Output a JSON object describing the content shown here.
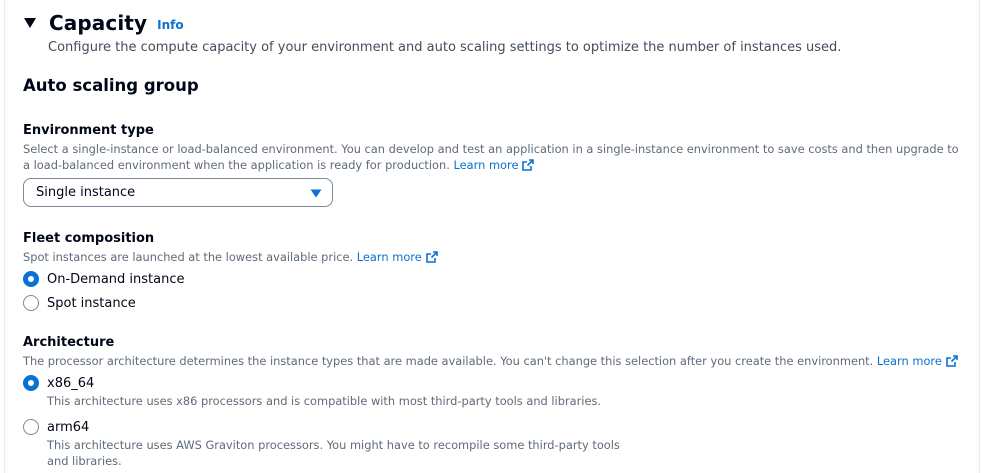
{
  "section": {
    "title": "Capacity",
    "info_label": "Info",
    "description": "Configure the compute capacity of your environment and auto scaling settings to optimize the number of instances used."
  },
  "auto_scaling": {
    "heading": "Auto scaling group"
  },
  "environment_type": {
    "label": "Environment type",
    "description": "Select a single-instance or load-balanced environment. You can develop and test an application in a single-instance environment to save costs and then upgrade to a load-balanced environment when the application is ready for production.",
    "learn_more": "Learn more",
    "selected_value": "Single instance"
  },
  "fleet_composition": {
    "label": "Fleet composition",
    "description": "Spot instances are launched at the lowest available price.",
    "learn_more": "Learn more",
    "options": [
      {
        "label": "On-Demand instance",
        "checked": true
      },
      {
        "label": "Spot instance",
        "checked": false
      }
    ]
  },
  "architecture": {
    "label": "Architecture",
    "description": "The processor architecture determines the instance types that are made available. You can't change this selection after you create the environment.",
    "learn_more": "Learn more",
    "options": [
      {
        "label": "x86_64",
        "checked": true,
        "description": "This architecture uses x86 processors and is compatible with most third-party tools and libraries."
      },
      {
        "label": "arm64",
        "checked": false,
        "description": "This architecture uses AWS Graviton processors. You might have to recompile some third-party tools and libraries."
      }
    ]
  },
  "colors": {
    "link": "#0972d3",
    "radio_selected": "#0972d3",
    "text_primary": "#000716",
    "text_secondary": "#5f6b7a"
  },
  "icons": {
    "caret": "caret-down-icon",
    "external": "external-link-icon",
    "dropdown": "dropdown-arrow-icon"
  }
}
